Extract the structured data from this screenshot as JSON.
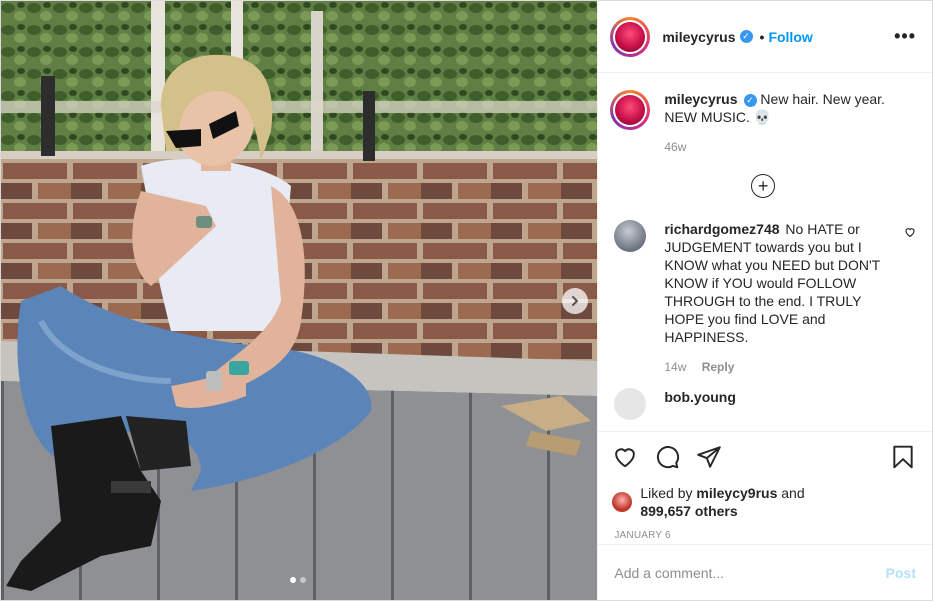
{
  "post": {
    "username": "mileycyrus",
    "separator": "•",
    "follow_label": "Follow",
    "more_label": "•••",
    "caption": {
      "username": "mileycyrus",
      "text": "New hair. New year. NEW MUSIC. 💀",
      "age": "46w"
    },
    "load_more_symbol": "+",
    "comments": [
      {
        "username": "richardgomez748",
        "text": "No HATE or JUDGEMENT towards you but I KNOW what you NEED but DON'T KNOW if YOU would FOLLOW THROUGH to the end. I TRULY HOPE you find LOVE and HAPPINESS.",
        "age": "14w",
        "reply_label": "Reply"
      },
      {
        "username": "bob.young",
        "text": ""
      }
    ],
    "likes": {
      "prefix": "Liked by",
      "user": "mileycy9rus",
      "conjunction": "and",
      "others": "899,657 others"
    },
    "date": "JANUARY 6",
    "add_comment_placeholder": "Add a comment...",
    "post_button": "Post",
    "carousel": {
      "total": 2,
      "active": 1
    }
  },
  "icons": {
    "verified": "verified-badge-icon",
    "heart": "heart-icon",
    "comment": "comment-bubble-icon",
    "share": "paper-plane-icon",
    "save": "bookmark-icon",
    "next": "chevron-right-icon"
  },
  "colors": {
    "link_blue": "#0095f6",
    "verified_blue": "#3897f0",
    "post_disabled": "#b2dffc",
    "muted_text": "#8e8e8e"
  }
}
